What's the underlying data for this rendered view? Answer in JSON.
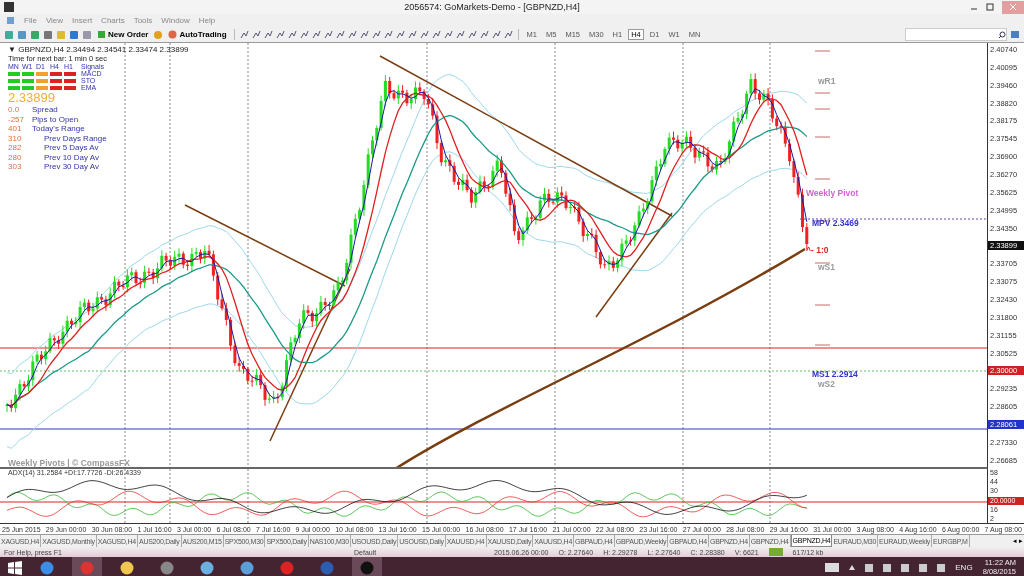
{
  "window": {
    "title": "2056574: GoMarkets-Demo - [GBPNZD,H4]"
  },
  "menu": [
    "File",
    "View",
    "Insert",
    "Charts",
    "Tools",
    "Window",
    "Help"
  ],
  "toolbar": {
    "new_order": "New Order",
    "autotrading": "AutoTrading",
    "timeframes": [
      {
        "label": "M1",
        "selected": false
      },
      {
        "label": "M5",
        "selected": false
      },
      {
        "label": "M15",
        "selected": false
      },
      {
        "label": "M30",
        "selected": false
      },
      {
        "label": "H1",
        "selected": false
      },
      {
        "label": "H4",
        "selected": true
      },
      {
        "label": "D1",
        "selected": false
      },
      {
        "label": "W1",
        "selected": false
      },
      {
        "label": "MN",
        "selected": false
      }
    ]
  },
  "chart": {
    "collapse": "▼",
    "symbol": "GBPNZD,H4",
    "ohlc": "2.34494 2.34541 2.33474 2.33899",
    "timer": "Time for next bar: 1 min 0 sec",
    "signals": {
      "columns": [
        "MN",
        "W1",
        "D1",
        "H4",
        "H1"
      ],
      "title": "Signals",
      "rows": [
        {
          "name": "MACD",
          "cells": [
            {
              "color": "#22cc22"
            },
            {
              "color": "#22cc22"
            },
            {
              "color": "#f0a030"
            },
            {
              "color": "#dd2222"
            },
            {
              "color": "#dd2222"
            }
          ]
        },
        {
          "name": "STO",
          "cells": [
            {
              "color": "#22cc22"
            },
            {
              "color": "#22cc22"
            },
            {
              "color": "#f0a030"
            },
            {
              "color": "#dd2222"
            },
            {
              "color": "#dd2222"
            }
          ]
        },
        {
          "name": "EMA",
          "cells": [
            {
              "color": "#22cc22"
            },
            {
              "color": "#22cc22"
            },
            {
              "color": "#f0a030"
            },
            {
              "color": "#dd2222"
            },
            {
              "color": "#dd2222"
            }
          ]
        }
      ]
    },
    "price": "2.33899",
    "stats": [
      {
        "value": "0.0",
        "label": "Spread"
      },
      {
        "value": "-257",
        "label": "Pips to Open"
      },
      {
        "value": "401",
        "label": "Today's Range"
      }
    ],
    "prev_stats": [
      {
        "value": "310",
        "label": "Prev Days Range"
      },
      {
        "value": "282",
        "label": "Prev 5 Days Av"
      },
      {
        "value": "280",
        "label": "Prev 10 Day Av"
      },
      {
        "value": "303",
        "label": "Prev 30 Day Av"
      }
    ],
    "labels": [
      {
        "text": "wR1",
        "color": "#999999"
      },
      {
        "text": "Weekly Pivot",
        "color": "#cc66cc"
      },
      {
        "text": "MPV  2.3469",
        "color": "#3333cc"
      },
      {
        "text": "^- 1:0",
        "color": "#dd2222"
      },
      {
        "text": "wS1",
        "color": "#999999"
      },
      {
        "text": "MS1  2.2914",
        "color": "#3333cc"
      },
      {
        "text": "wS2",
        "color": "#999999"
      },
      {
        "text": "Weekly Pivots | © CompassFX",
        "color": "#999999"
      }
    ],
    "price_axis": [
      {
        "text": "2.40740",
        "kind": "tick"
      },
      {
        "text": "2.40095",
        "kind": "tick"
      },
      {
        "text": "2.39460",
        "kind": "tick"
      },
      {
        "text": "2.38820",
        "kind": "tick"
      },
      {
        "text": "2.38175",
        "kind": "tick"
      },
      {
        "text": "2.37545",
        "kind": "tick"
      },
      {
        "text": "2.36900",
        "kind": "tick"
      },
      {
        "text": "2.36270",
        "kind": "tick"
      },
      {
        "text": "2.35625",
        "kind": "tick"
      },
      {
        "text": "2.34995",
        "kind": "tick"
      },
      {
        "text": "2.34350",
        "kind": "tick"
      },
      {
        "text": "2.33899",
        "kind": "badge",
        "color": "#111111"
      },
      {
        "text": "2.33705",
        "kind": "tick"
      },
      {
        "text": "2.33075",
        "kind": "tick"
      },
      {
        "text": "2.32430",
        "kind": "tick"
      },
      {
        "text": "2.31800",
        "kind": "tick"
      },
      {
        "text": "2.31155",
        "kind": "tick"
      },
      {
        "text": "2.30525",
        "kind": "tick"
      },
      {
        "text": "2.30000",
        "kind": "badge",
        "color": "#cc2222"
      },
      {
        "text": "2.29235",
        "kind": "tick"
      },
      {
        "text": "2.28605",
        "kind": "tick"
      },
      {
        "text": "2.28061",
        "kind": "badge",
        "color": "#2233cc"
      },
      {
        "text": "2.27330",
        "kind": "tick"
      },
      {
        "text": "2.26685",
        "kind": "tick"
      }
    ],
    "indicator": {
      "label": "ADX(14) 31.2584 +DI:17.7726 -DI:26.4339",
      "axis": [
        {
          "text": "58",
          "kind": "tick"
        },
        {
          "text": "44",
          "kind": "tick"
        },
        {
          "text": "30",
          "kind": "tick"
        },
        {
          "text": "20.0000",
          "kind": "badge",
          "color": "#cc2222"
        },
        {
          "text": "16",
          "kind": "tick"
        },
        {
          "text": "2",
          "kind": "tick"
        }
      ]
    },
    "time_axis": [
      "25 Jun 2015",
      "29 Jun 00:00",
      "30 Jun 08:00",
      "1 Jul 16:00",
      "3 Jul 00:00",
      "6 Jul 08:00",
      "7 Jul 16:00",
      "9 Jul 00:00",
      "10 Jul 08:00",
      "13 Jul 16:00",
      "15 Jul 00:00",
      "16 Jul 08:00",
      "17 Jul 16:00",
      "21 Jul 00:00",
      "22 Jul 08:00",
      "23 Jul 16:00",
      "27 Jul 00:00",
      "28 Jul 08:00",
      "29 Jul 16:00",
      "31 Jul 00:00",
      "3 Aug 08:00",
      "4 Aug 16:00",
      "6 Aug 00:00",
      "7 Aug 08:00"
    ]
  },
  "tabs": [
    {
      "label": "XAGUSD,H4",
      "selected": false
    },
    {
      "label": "XAGUSD,Monthly",
      "selected": false
    },
    {
      "label": "XAGUSD,H4",
      "selected": false
    },
    {
      "label": "AUS200,Daily",
      "selected": false
    },
    {
      "label": "AUS200,M15",
      "selected": false
    },
    {
      "label": "SPX500,M30",
      "selected": false
    },
    {
      "label": "SPX500,Daily",
      "selected": false
    },
    {
      "label": "NAS100,M30",
      "selected": false
    },
    {
      "label": "USOUSD,Daily",
      "selected": false
    },
    {
      "label": "USOUSD,Daily",
      "selected": false
    },
    {
      "label": "XAUUSD,H4",
      "selected": false
    },
    {
      "label": "XAUUSD,Daily",
      "selected": false
    },
    {
      "label": "XAUUSD,H4",
      "selected": false
    },
    {
      "label": "GBPAUD,H4",
      "selected": false
    },
    {
      "label": "GBPAUD,Weekly",
      "selected": false
    },
    {
      "label": "GBPAUD,H4",
      "selected": false
    },
    {
      "label": "GBPNZD,H4",
      "selected": false
    },
    {
      "label": "GBPNZD,H4",
      "selected": false
    },
    {
      "label": "GBPNZD,H4",
      "selected": true
    },
    {
      "label": "EURAUD,M30",
      "selected": false
    },
    {
      "label": "EURAUD,Weekly",
      "selected": false
    },
    {
      "label": "EURGBP,M",
      "selected": false
    }
  ],
  "tab_scroll": [
    "◂",
    "▸"
  ],
  "status_bar": {
    "help": "For Help, press F1",
    "profile": "Default",
    "fields": [
      "2015.06.26 00:00",
      "O: 2.27640",
      "H: 2.29278",
      "L: 2.27640",
      "C: 2.28380",
      "V: 6621"
    ],
    "traffic": "617/12 kb"
  },
  "taskbar": {
    "language": "ENG",
    "time": "11:22 AM",
    "date": "8/08/2015"
  }
}
